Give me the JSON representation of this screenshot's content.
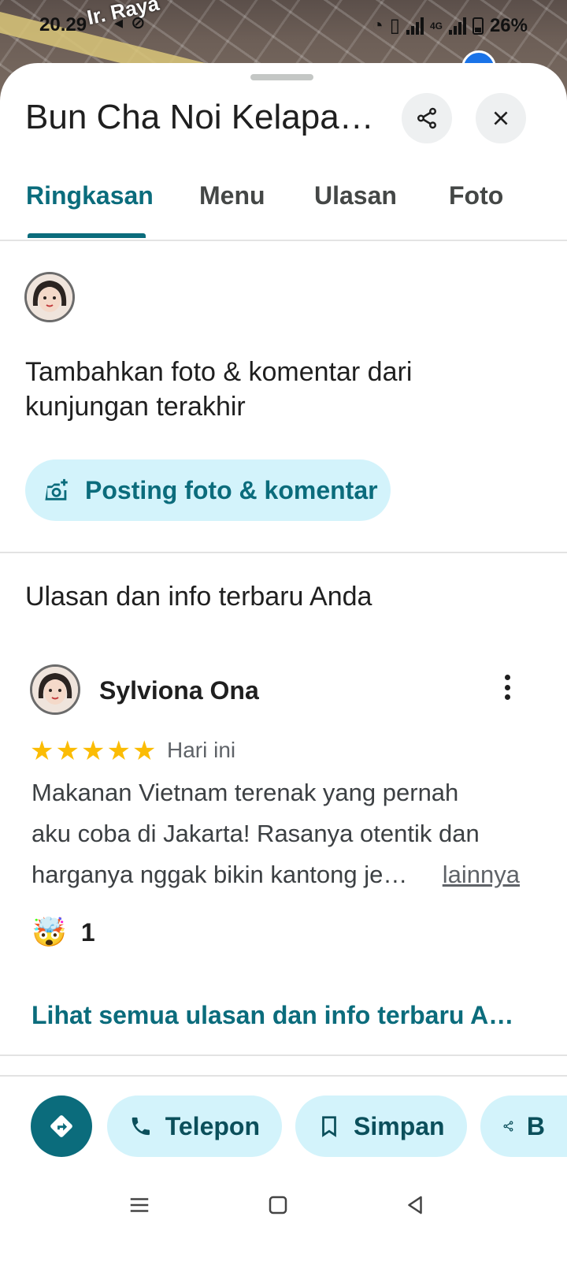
{
  "status_bar": {
    "time": "20.29",
    "battery": "26%",
    "network": "4G"
  },
  "map": {
    "road_label": "Ir. Raya"
  },
  "place": {
    "title": "Bun Cha Noi Kelapa…",
    "share_icon": "share-icon",
    "close_icon": "close-icon"
  },
  "tabs": [
    {
      "label": "Ringkasan",
      "active": true
    },
    {
      "label": "Menu",
      "active": false
    },
    {
      "label": "Ulasan",
      "active": false
    },
    {
      "label": "Foto",
      "active": false
    }
  ],
  "add_photo": {
    "prompt": "Tambahkan foto & komentar dari kunjungan terakhir",
    "button_label": "Posting foto & komentar",
    "button_icon": "add-photo-icon"
  },
  "reviews_section": {
    "title": "Ulasan dan info terbaru Anda",
    "review": {
      "author": "Sylviona Ona",
      "rating": 5,
      "date": "Hari ini",
      "text_line1": "Makanan Vietnam terenak yang pernah",
      "text_line2": "aku coba di Jakarta! Rasanya otentik dan",
      "text_line3": "harganya nggak bikin kantong je…",
      "more_label": "lainnya",
      "reaction_emoji": "🤯",
      "reaction_count": "1"
    },
    "see_all_label": "Lihat semua ulasan dan info terbaru And…"
  },
  "actions": {
    "directions_icon": "directions-icon",
    "call_label": "Telepon",
    "save_label": "Simpan",
    "share_label": "B"
  },
  "colors": {
    "accent": "#0b6c7c",
    "pill_bg": "#d3f3fb",
    "star": "#fbbc04"
  }
}
